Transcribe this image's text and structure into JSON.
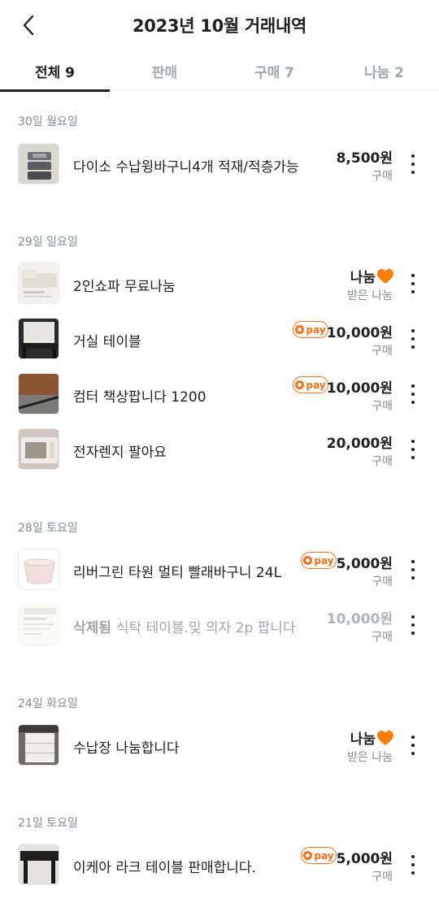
{
  "header": {
    "title": "2023년 10월 거래내역"
  },
  "tabs": [
    {
      "label": "전체 9",
      "active": true
    },
    {
      "label": "판매",
      "active": false
    },
    {
      "label": "구매 7",
      "active": false
    },
    {
      "label": "나눔 2",
      "active": false
    }
  ],
  "sections": [
    {
      "label": "30일 월요일"
    },
    {
      "label": "29일 일요일"
    },
    {
      "label": "28일 토요일"
    },
    {
      "label": "24일 화요일"
    },
    {
      "label": "21일 토요일"
    }
  ],
  "items": [
    {
      "title": "다이소 수납윙바구니4개 적재/적층가능",
      "price": "8,500원",
      "type": "구매",
      "pay": false
    },
    {
      "title": "2인쇼파 무료나눔",
      "price": "나눔",
      "type": "받은 나눔",
      "pay": false,
      "heart": true
    },
    {
      "title": "거실 테이블",
      "price": "10,000원",
      "type": "구매",
      "pay": true
    },
    {
      "title": "컴터 책상팝니다 1200",
      "price": "10,000원",
      "type": "구매",
      "pay": true
    },
    {
      "title": "전자렌지 팔아요",
      "price": "20,000원",
      "type": "구매",
      "pay": false
    },
    {
      "title": "리버그린 타원 멀티 빨래바구니 24L",
      "price": "5,000원",
      "type": "구매",
      "pay": true
    },
    {
      "deleted_label": "삭제됨",
      "title": "식탁 테이블.및 의자 2p 팝니다",
      "price": "10,000원",
      "type": "구매",
      "pay": false,
      "deleted": true
    },
    {
      "title": "수납장 나눔합니다",
      "price": "나눔",
      "type": "받은 나눔",
      "pay": false,
      "heart": true
    },
    {
      "title": "이케아 라크 테이블 판매합니다.",
      "price": "5,000원",
      "type": "구매",
      "pay": true
    }
  ],
  "pay_badge": {
    "label": "pay"
  },
  "colors": {
    "accent": "#ff6f0f",
    "text": "#212124",
    "muted": "#868b94",
    "heart": "#ff7e00"
  }
}
